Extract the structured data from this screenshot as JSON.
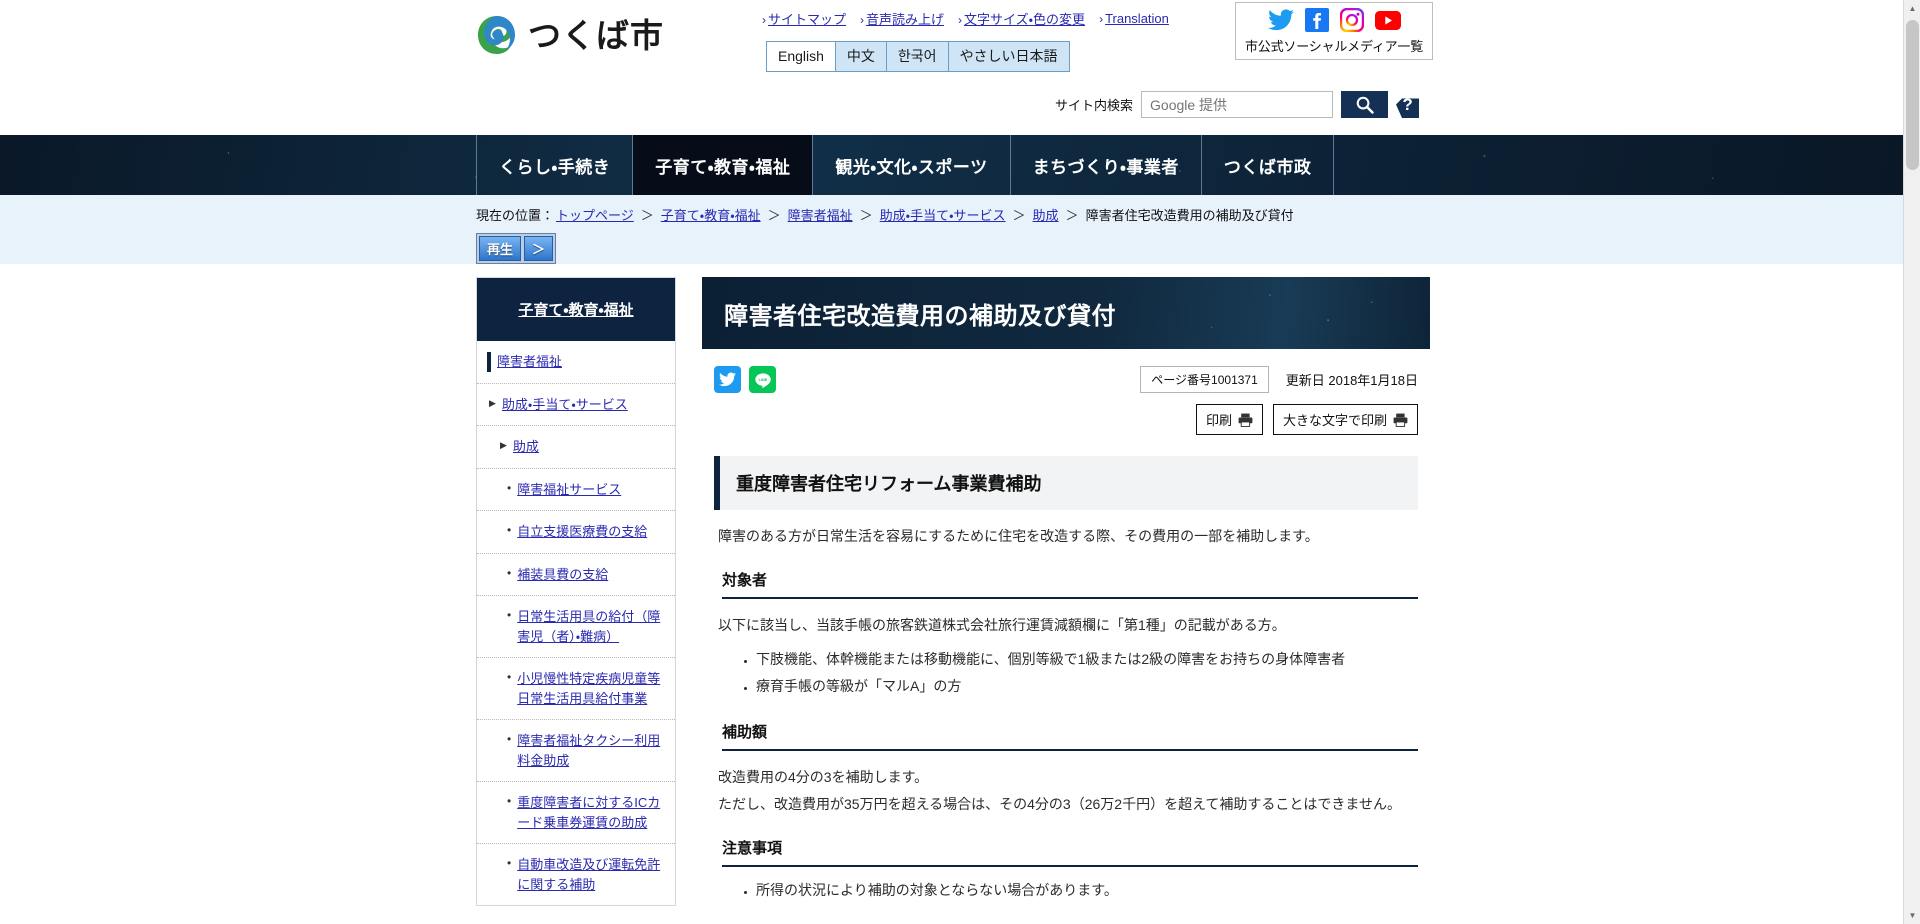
{
  "site": {
    "logo_text": "つくば市",
    "logo_alt": "tsukuba-city-logo"
  },
  "header": {
    "util_links": [
      {
        "label": "サイトマップ",
        "name": "sitemap"
      },
      {
        "label": "音声読み上げ",
        "name": "voice-reading"
      },
      {
        "label": "文字サイズ・色の変更",
        "name": "text-size-color"
      },
      {
        "label": "Translation",
        "name": "translation"
      }
    ],
    "languages": [
      {
        "label": "English",
        "selected": true
      },
      {
        "label": "中文",
        "selected": false
      },
      {
        "label": "한국어",
        "selected": false
      },
      {
        "label": "やさしい日本語",
        "selected": false
      }
    ],
    "social": {
      "caption": "市公式ソーシャルメディア一覧",
      "items": [
        "twitter-icon",
        "facebook-icon",
        "instagram-icon",
        "youtube-icon"
      ]
    },
    "search": {
      "label": "サイト内検索",
      "placeholder": "Google 提供",
      "value": "",
      "button_icon": "search-icon",
      "help_label": "?"
    }
  },
  "gnav": {
    "items": [
      {
        "label": "くらし・手続き",
        "active": false
      },
      {
        "label": "子育て・教育・福祉",
        "active": true
      },
      {
        "label": "観光・文化・スポーツ",
        "active": false
      },
      {
        "label": "まちづくり・事業者",
        "active": false
      },
      {
        "label": "つくば市政",
        "active": false
      }
    ]
  },
  "breadcrumb": {
    "prefix": "現在の位置：",
    "items": [
      {
        "label": "トップページ",
        "link": true
      },
      {
        "label": "子育て・教育・福祉",
        "link": true
      },
      {
        "label": "障害者福祉",
        "link": true
      },
      {
        "label": "助成・手当て・サービス",
        "link": true
      },
      {
        "label": "助成",
        "link": true
      },
      {
        "label": "障害者住宅改造費用の補助及び貸付",
        "link": false
      }
    ],
    "separator": "＞"
  },
  "player": {
    "play_label": "再生",
    "next_label": "＞"
  },
  "sidebar": {
    "heading": "子育て・教育・福祉",
    "items": [
      {
        "label": "障害者福祉",
        "level": 0,
        "marker": "bar"
      },
      {
        "label": "助成・手当て・サービス",
        "level": 1,
        "marker": "triangle"
      },
      {
        "label": "助成",
        "level": 2,
        "marker": "triangle"
      },
      {
        "label": "障害福祉サービス",
        "level": 3,
        "marker": "dot"
      },
      {
        "label": "自立支援医療費の支給",
        "level": 3,
        "marker": "dot"
      },
      {
        "label": "補装具費の支給",
        "level": 3,
        "marker": "dot"
      },
      {
        "label": "日常生活用具の給付（障害児（者）・難病）",
        "level": 3,
        "marker": "dot"
      },
      {
        "label": "小児慢性特定疾病児童等日常生活用具給付事業",
        "level": 3,
        "marker": "dot"
      },
      {
        "label": "障害者福祉タクシー利用料金助成",
        "level": 3,
        "marker": "dot"
      },
      {
        "label": "重度障害者に対するICカード乗車券運賃の助成",
        "level": 3,
        "marker": "dot"
      },
      {
        "label": "自動車改造及び運転免許に関する補助",
        "level": 3,
        "marker": "dot"
      }
    ]
  },
  "main": {
    "page_title": "障害者住宅改造費用の補助及び貸付",
    "share": [
      {
        "name": "twitter-share",
        "color": "#1d9bf0"
      },
      {
        "name": "line-share",
        "color": "#06c755"
      }
    ],
    "page_number": "ページ番号1001371",
    "updated": "更新日 2018年1月18日",
    "print_buttons": [
      {
        "label": "印刷",
        "icon": "printer-icon"
      },
      {
        "label": "大きな文字で印刷",
        "icon": "printer-icon"
      }
    ],
    "section_title": "重度障害者住宅リフォーム事業費補助",
    "intro": "障害のある方が日常生活を容易にするために住宅を改造する際、その費用の一部を補助します。",
    "subsections": [
      {
        "title": "対象者",
        "paragraphs": [
          "以下に該当し、当該手帳の旅客鉄道株式会社旅行運賃減額欄に「第1種」の記載がある方。"
        ],
        "bullets": [
          "下肢機能、体幹機能または移動機能に、個別等級で1級または2級の障害をお持ちの身体障害者",
          "療育手帳の等級が「マルA」の方"
        ]
      },
      {
        "title": "補助額",
        "paragraphs": [
          "改造費用の4分の3を補助します。",
          "ただし、改造費用が35万円を超える場合は、その4分の3（26万2千円）を超えて補助することはできません。"
        ],
        "bullets": []
      },
      {
        "title": "注意事項",
        "paragraphs": [],
        "bullets": [
          "所得の状況により補助の対象とならない場合があります。"
        ]
      }
    ]
  },
  "colors": {
    "navy": "#0d2340",
    "link": "#2a2ab0",
    "page_bg": "#e8f2fb",
    "lang_bg": "#cfe5f5"
  }
}
